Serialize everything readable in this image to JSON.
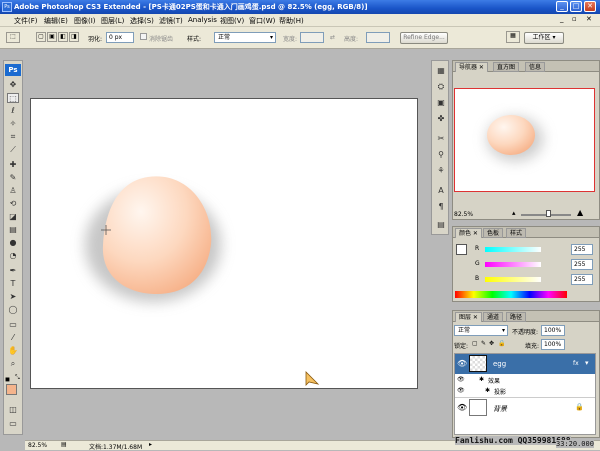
{
  "window": {
    "title": "Adobe Photoshop CS3 Extended - [PS卡通02PS蛋和卡通入门画鸡蛋.psd @ 82.5% (egg, RGB/8)]",
    "app_icon": "Ps",
    "controls": [
      "_",
      "□",
      "✕"
    ],
    "doc_controls": [
      "_",
      "▫",
      "✕"
    ]
  },
  "menu": [
    "文件(F)",
    "编辑(E)",
    "图像(I)",
    "图层(L)",
    "选择(S)",
    "滤镜(T)",
    "Analysis",
    "视图(V)",
    "窗口(W)",
    "帮助(H)"
  ],
  "options": {
    "feather_label": "羽化:",
    "feather_value": "0 px",
    "antialias_label": "消除锯齿",
    "style_label": "样式:",
    "style_value": "正常",
    "width_label": "宽度:",
    "height_label": "高度:",
    "refine_edge": "Refine Edge...",
    "workspace": "工作区"
  },
  "toolbar": {
    "logo": "Ps",
    "tools": [
      "move-icon",
      "marquee-icon",
      "lasso-icon",
      "magic-wand-icon",
      "crop-icon",
      "slice-icon",
      "healing-icon",
      "brush-icon",
      "stamp-icon",
      "history-brush-icon",
      "eraser-icon",
      "gradient-icon",
      "blur-icon",
      "dodge-icon",
      "pen-icon",
      "type-icon",
      "path-select-icon",
      "shape-icon",
      "notes-icon",
      "eyedropper-icon",
      "hand-icon",
      "zoom-icon"
    ],
    "fg_color": "#f4b48c",
    "bg_color": "#fde3d2"
  },
  "navigator": {
    "tabs": [
      "导航器",
      "直方图",
      "信息"
    ],
    "zoom": "82.5%"
  },
  "color_panel": {
    "tabs": [
      "颜色",
      "色板",
      "样式"
    ],
    "channels": [
      {
        "label": "R",
        "value": "255"
      },
      {
        "label": "G",
        "value": "255"
      },
      {
        "label": "B",
        "value": "255"
      }
    ]
  },
  "layers": {
    "tabs": [
      "图层",
      "通道",
      "路径"
    ],
    "blend_mode": "正常",
    "opacity_label": "不透明度:",
    "opacity_value": "100%",
    "lock_label": "锁定:",
    "fill_label": "填充:",
    "fill_value": "100%",
    "items": [
      {
        "name": "egg",
        "selected": true,
        "fx": "fx"
      },
      {
        "name": "效果",
        "sub": true
      },
      {
        "name": "投影",
        "sub": true
      },
      {
        "name": "背景",
        "locked": true
      }
    ]
  },
  "status": {
    "zoom": "82.5%",
    "doc_info": "文档:1.37M/1.68M"
  },
  "watermark": {
    "site": "Fanlishu.com QQ359981688",
    "time": "33:20.000"
  },
  "colors": {
    "egg_light": "#fff3ea",
    "egg_dark": "#f8b88f",
    "layer_selected": "#3a6fa8"
  }
}
